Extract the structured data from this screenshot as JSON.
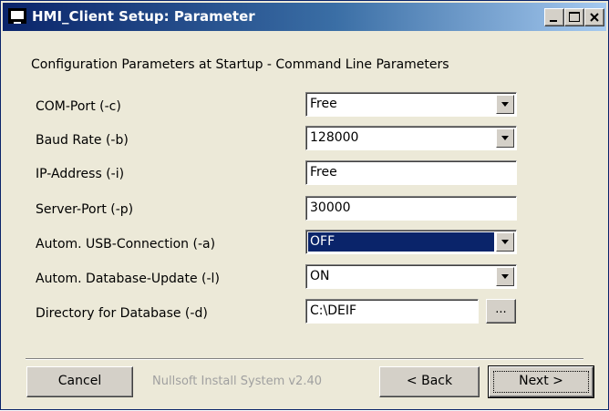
{
  "window": {
    "title": "HMI_Client Setup: Parameter"
  },
  "heading": "Configuration Parameters at Startup - Command Line Parameters",
  "fields": [
    {
      "label": "COM-Port (-c)",
      "type": "combo",
      "value": "Free"
    },
    {
      "label": "Baud Rate (-b)",
      "type": "combo",
      "value": "128000"
    },
    {
      "label": "IP-Address (-i)",
      "type": "text",
      "value": "Free"
    },
    {
      "label": "Server-Port (-p)",
      "type": "text",
      "value": "30000"
    },
    {
      "label": "Autom. USB-Connection (-a)",
      "type": "combo",
      "value": "OFF",
      "selected": true
    },
    {
      "label": "Autom. Database-Update (-l)",
      "type": "combo",
      "value": "ON"
    },
    {
      "label": "Directory for Database (-d)",
      "type": "text",
      "value": "C:\\DEIF"
    }
  ],
  "browse_label": "...",
  "footer": {
    "brand": "Nullsoft Install System v2.40",
    "cancel_label": "Cancel",
    "back_label": "< Back",
    "next_label": "Next >"
  },
  "colors": {
    "title_bar": "#0a246a",
    "selection": "#0a246a",
    "face": "#ece9d8"
  }
}
